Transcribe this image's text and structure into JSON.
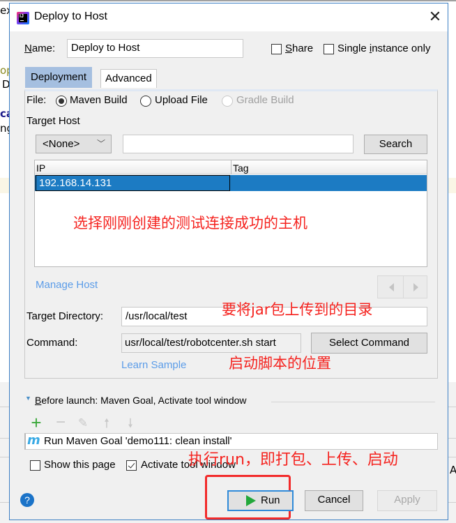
{
  "background": {
    "fragments": [
      "ex",
      "op",
      "D",
      "ca",
      "ng"
    ],
    "right_fragment": "A"
  },
  "dialog": {
    "title": "Deploy to Host",
    "close_icon": "close-icon",
    "app_icon": "intellij-idea-icon",
    "name_label_underline": "N",
    "name_label_rest": "ame:",
    "name_value": "Deploy to Host",
    "share": {
      "underline": "S",
      "rest": "hare",
      "checked": false
    },
    "single_instance": {
      "pre": "Single ",
      "underline": "i",
      "rest": "nstance only",
      "checked": false
    },
    "tabs": [
      {
        "label": "Deployment",
        "active": true
      },
      {
        "label": "Advanced",
        "active": false
      }
    ],
    "file_label": "File:",
    "file_options": [
      {
        "label": "Maven Build",
        "selected": true,
        "enabled": true
      },
      {
        "label": "Upload File",
        "selected": false,
        "enabled": true
      },
      {
        "label": "Gradle Build",
        "selected": false,
        "enabled": false
      }
    ],
    "target_host_label": "Target Host",
    "host_select_value": "<None>",
    "search_value": "",
    "search_button": "Search",
    "table": {
      "columns": [
        "IP",
        "Tag"
      ],
      "rows": [
        {
          "ip": "192.168.14.131",
          "tag": "",
          "selected": true
        }
      ]
    },
    "manage_host_link": "Manage Host",
    "target_directory_label": "Target Directory:",
    "target_directory_value": "/usr/local/test",
    "command_label": "Command:",
    "command_value": "usr/local/test/robotcenter.sh start",
    "select_command_button": "Select Command",
    "learn_sample_link": "Learn Sample",
    "before_launch": {
      "underline": "B",
      "rest": "efore launch: Maven Goal, Activate tool window",
      "tools": [
        "add-icon",
        "remove-icon",
        "edit-icon",
        "move-up-icon",
        "move-down-icon"
      ],
      "items": [
        "Run Maven Goal 'demo111: clean install'"
      ]
    },
    "show_this_page": {
      "label": "Show this page",
      "checked": false
    },
    "activate_tool_window": {
      "label": "Activate tool window",
      "checked": true
    },
    "buttons": {
      "run": "Run",
      "cancel": "Cancel",
      "apply": "Apply"
    }
  },
  "annotations": {
    "host": "选择刚刚创建的测试连接成功的主机",
    "directory": "要将jar包上传到的目录",
    "script": "启动脚本的位置",
    "run": "执行run，即打包、上传、启动",
    "color": "#f5231f"
  }
}
